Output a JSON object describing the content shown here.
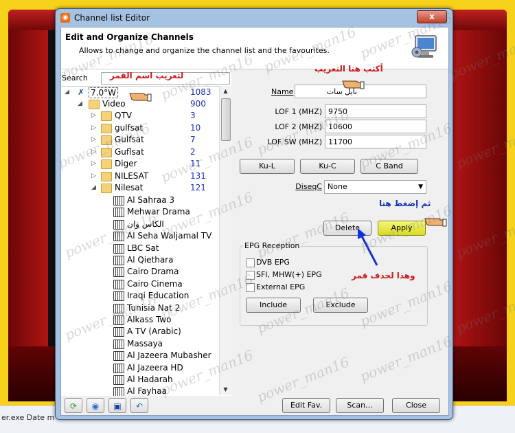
{
  "window": {
    "title": "Channel list Editor",
    "close_label": "x"
  },
  "header": {
    "title": "Edit and Organize Channels",
    "subtitle": "Allows to change and organize the channel list and the favourites."
  },
  "search": {
    "label": "Search",
    "value": ""
  },
  "tree": {
    "satellite": {
      "label": "7.0°W",
      "count": "1083"
    },
    "video": {
      "label": "Video",
      "count": "900"
    },
    "folders": [
      {
        "label": "QTV",
        "count": "3"
      },
      {
        "label": "gulfsat",
        "count": "10"
      },
      {
        "label": "Gulfsat",
        "count": "7"
      },
      {
        "label": "Guflsat",
        "count": "2"
      },
      {
        "label": "Diger",
        "count": "11"
      },
      {
        "label": "NILESAT",
        "count": "131"
      },
      {
        "label": "Nilesat",
        "count": "121"
      }
    ],
    "channels": [
      "Al Sahraa 3",
      "Mehwar Drama",
      "الكاس وان",
      "Al Seha Waljamal TV",
      "LBC Sat",
      "Al Qiethara",
      "Cairo Drama",
      "Cairo Cinema",
      "Iraqi Education",
      "Tunisia Nat 2",
      "Alkass Two",
      "A TV (Arabic)",
      "Massaya",
      "Al Jazeera Mubasher",
      "Al Jazeera HD",
      "Al Hadarah",
      "Al Fayhaa"
    ]
  },
  "form": {
    "name_label": "Name",
    "name_value": "نايل سات",
    "lof1_label": "LOF 1 (MHZ)",
    "lof1_value": "9750",
    "lof2_label": "LOF 2 (MHZ)",
    "lof2_value": "10600",
    "lofsw_label": "LOF SW (MHZ)",
    "lofsw_value": "11700",
    "band_buttons": [
      "Ku-L",
      "Ku-C",
      "C Band"
    ],
    "diseqc_label": "DiseqC",
    "diseqc_value": "None",
    "delete_label": "Delete",
    "apply_label": "Apply"
  },
  "epg": {
    "title": "EPG Reception",
    "options": [
      "DVB EPG",
      "SFI, MHW(+) EPG",
      "External EPG"
    ],
    "include_label": "Include",
    "exclude_label": "Exclude"
  },
  "footer": {
    "edit_fav_label": "Edit Fav.",
    "scan_label": "Scan...",
    "close_label": "Close"
  },
  "annotations": {
    "satellite_hint": "لتعريب اسم القمر",
    "name_hint": "أكتب هنا التعريب",
    "apply_hint": "ثم إضغط هنا",
    "delete_hint": "وهذا لحذف قمر"
  },
  "watermark": "power_man16",
  "background": {
    "explorer_text": "er.exe   Date m"
  }
}
